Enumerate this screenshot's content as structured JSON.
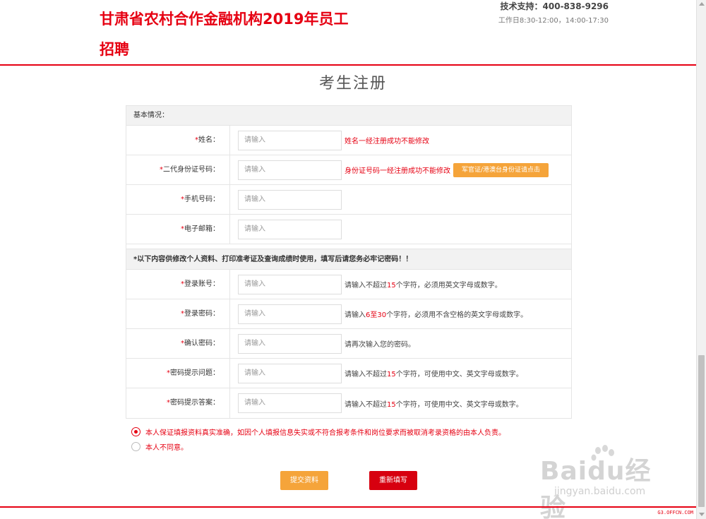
{
  "header": {
    "title": "甘肃省农村合作金融机构2019年员工招聘",
    "support_phone": "技术支持：400-838-9296",
    "support_hours": "工作日8:30-12:00，14:00-17:30"
  },
  "page_title": "考生注册",
  "basic_section": {
    "heading": "基本情况：",
    "fields": [
      {
        "label": "姓名：",
        "placeholder": "请输入",
        "hint": "姓名一经注册成功不能修改"
      },
      {
        "label": "二代身份证号码：",
        "placeholder": "请输入",
        "hint": "身份证号码一经注册成功不能修改",
        "button": "军官证/港澳台身份证请点击"
      },
      {
        "label": "手机号码：",
        "placeholder": "请输入"
      },
      {
        "label": "电子邮箱：",
        "placeholder": "请输入"
      }
    ]
  },
  "account_section": {
    "heading": "*以下内容供修改个人资料、打印准考证及查询成绩时使用，填写后请您务必牢记密码！！",
    "fields": [
      {
        "label": "登录账号：",
        "placeholder": "请输入",
        "hint_pre": "请输入不超过",
        "hint_num": "15",
        "hint_post": "个字符，必须用英文字母或数字。"
      },
      {
        "label": "登录密码：",
        "placeholder": "请输入",
        "hint_pre": "请输入",
        "hint_num": "6至30",
        "hint_post": "个字符，必须用不含空格的英文字母或数字。"
      },
      {
        "label": "确认密码：",
        "placeholder": "请输入",
        "hint": "请再次输入您的密码。"
      },
      {
        "label": "密码提示问题：",
        "placeholder": "请输入",
        "hint_pre": "请输入不超过",
        "hint_num": "15",
        "hint_post": "个字符，可使用中文、英文字母或数字。"
      },
      {
        "label": "密码提示答案：",
        "placeholder": "请输入",
        "hint_pre": "请输入不超过",
        "hint_num": "15",
        "hint_post": "个字符，可使用中文、英文字母或数字。"
      }
    ]
  },
  "agreement": {
    "agree": "本人保证填报资料真实准确，如因个人填报信息失实或不符合报考条件和岗位要求而被取消考录资格的由本人负责。",
    "disagree": "本人不同意。",
    "selected": "agree"
  },
  "buttons": {
    "submit": "提交资料",
    "reset": "重新填写"
  },
  "footer": {
    "source": "G3.OFFCN.COM"
  },
  "watermark": {
    "main": "Baidu经验",
    "sub": "jingyan.baidu.com"
  },
  "colors": {
    "brand_red": "#e60012",
    "orange": "#f5a43a",
    "reset_red": "#d7000f"
  }
}
